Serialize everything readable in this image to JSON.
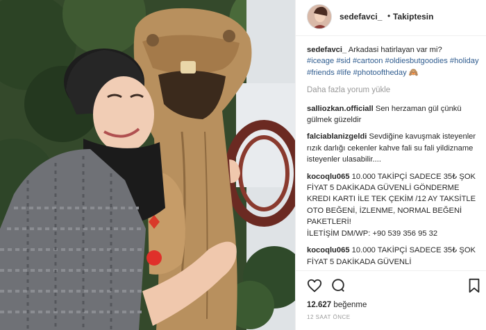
{
  "post": {
    "author": "sedefavci_",
    "header_dot": "•",
    "follow_label": "Takiptesin",
    "caption": {
      "user": "sedefavci_",
      "text": "Arkadasi hatirlayan var mi?",
      "hashtags": [
        "#iceage",
        "#sid",
        "#cartoon",
        "#oldiesbutgoodies",
        "#holiday",
        "#friends",
        "#life",
        "#photooftheday"
      ],
      "emoji": "🙈"
    },
    "load_more": "Daha fazla yorum yükle",
    "comments": [
      {
        "user": "salliozkan.officiall",
        "text": "Sen herzaman gül çünkü gülmek güzeldir"
      },
      {
        "user": "falciablanizgeldi",
        "text": "Sevdiğine kavuşmak isteyenler rızık darlığı cekenler kahve fali su fali yildizname isteyenler ulasabilir...."
      },
      {
        "user": "kocoqlu065",
        "text": "10.000 TAKİPÇİ SADECE 35₺ ŞOK FİYAT 5 DAKİKADA GÜVENLİ GÖNDERME",
        "lines": [
          "KREDI KARTI İLE TEK ÇEKİM /12 AY TAKSİTLE",
          "OTO BEĞENİ, İZLENME, NORMAL BEĞENİ PAKETLERİ!",
          "İLETİŞİM DM/WP: +90 539 356 95 32"
        ]
      },
      {
        "user": "kocoqlu065",
        "text": "10.000 TAKİPÇİ SADECE 35₺ ŞOK FİYAT 5 DAKİKADA GÜVENLİ"
      }
    ],
    "likes_count": "12.627",
    "likes_label": "beğenme",
    "timestamp": "12 SAAT ÖNCE",
    "icons": {
      "like": "heart-icon",
      "comment": "comment-bubble-icon",
      "save": "bookmark-icon"
    }
  }
}
